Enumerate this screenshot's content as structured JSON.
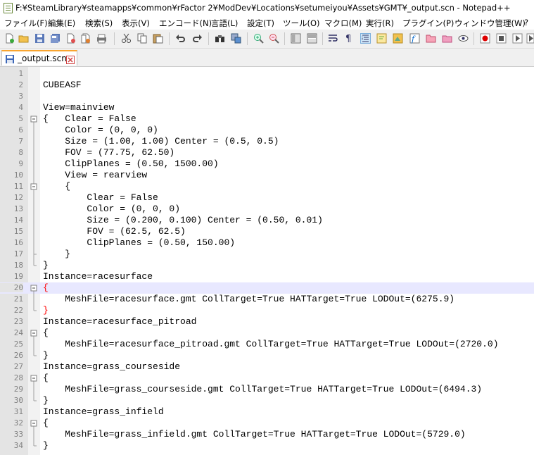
{
  "window": {
    "title": "F:¥SteamLibrary¥steamapps¥common¥rFactor 2¥ModDev¥Locations¥setumeiyou¥Assets¥GMT¥_output.scn - Notepad++"
  },
  "menu": [
    "ファイル(F)",
    "編集(E)",
    "検索(S)",
    "表示(V)",
    "エンコード(N)",
    "言語(L)",
    "設定(T)",
    "ツール(O)",
    "マクロ(M)",
    "実行(R)",
    "プラグイン(P)",
    "ウィンドウ管理(W)",
    "?"
  ],
  "toolbar_icons": [
    "new-file-icon",
    "open-file-icon",
    "save-icon",
    "save-all-icon",
    "close-icon",
    "close-all-icon",
    "print-icon",
    "cut-icon",
    "copy-icon",
    "paste-icon",
    "undo-icon",
    "redo-icon",
    "find-icon",
    "replace-icon",
    "zoom-in-icon",
    "zoom-out-icon",
    "sync-vertical-icon",
    "sync-horizontal-icon",
    "word-wrap-icon",
    "show-all-chars-icon",
    "indent-guide-icon",
    "lang-define-icon",
    "doc-map-icon",
    "function-list-icon",
    "folder-workspace-icon",
    "monitor-icon",
    "record-macro-icon",
    "stop-record-icon",
    "play-macro-icon"
  ],
  "tab": {
    "label": "_output.scn"
  },
  "editor": {
    "current_line": 20,
    "lines": [
      "",
      "CUBEASF",
      "",
      "View=mainview",
      "{   Clear = False",
      "    Color = (0, 0, 0)",
      "    Size = (1.00, 1.00) Center = (0.5, 0.5)",
      "    FOV = (77.75, 62.50)",
      "    ClipPlanes = (0.50, 1500.00)",
      "    View = rearview",
      "    {",
      "        Clear = False",
      "        Color = (0, 0, 0)",
      "        Size = (0.200, 0.100) Center = (0.50, 0.01)",
      "        FOV = (62.5, 62.5)",
      "        ClipPlanes = (0.50, 150.00)",
      "    }",
      "}",
      "Instance=racesurface",
      "{",
      "    MeshFile=racesurface.gmt CollTarget=True HATTarget=True LODOut=(6275.9)",
      "}",
      "Instance=racesurface_pitroad",
      "{",
      "    MeshFile=racesurface_pitroad.gmt CollTarget=True HATTarget=True LODOut=(2720.0)",
      "}",
      "Instance=grass_courseside",
      "{",
      "    MeshFile=grass_courseside.gmt CollTarget=True HATTarget=True LODOut=(6494.3)",
      "}",
      "Instance=grass_infield",
      "{",
      "    MeshFile=grass_infield.gmt CollTarget=True HATTarget=True LODOut=(5729.0)",
      "}"
    ],
    "brace_match_lines": [
      20,
      22
    ]
  },
  "colors": {
    "current_line_bg": "#e8e8ff",
    "brace_match": "#ff0000",
    "tab_accent": "#f9a530"
  }
}
